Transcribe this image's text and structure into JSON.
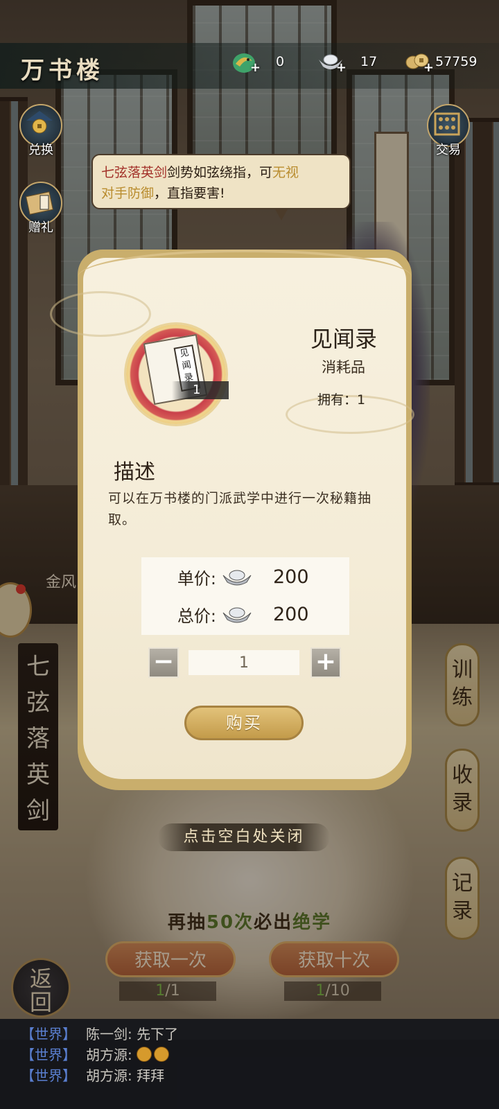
{
  "header": {
    "title": "万书楼",
    "currencies": [
      {
        "icon": "jade-dragon-icon",
        "value": "0"
      },
      {
        "icon": "silver-ingot-icon",
        "value": "17"
      },
      {
        "icon": "copper-coins-icon",
        "value": "57759"
      }
    ]
  },
  "side_buttons": {
    "exchange": "兑换",
    "gift": "赠礼",
    "trade": "交易"
  },
  "speech": {
    "part1": "七弦落英剑",
    "part2": "剑势如弦绕指，可",
    "part3": "无视",
    "part4": "对手防御",
    "part5": "，直指要害!"
  },
  "modal": {
    "item_name": "见闻录",
    "item_type": "消耗品",
    "owned_label": "拥有：1",
    "icon_quantity": "1",
    "book_text": "见闻录",
    "desc_title": "描述",
    "desc_text": "可以在万书楼的门派武学中进行一次秘籍抽取。",
    "unit_price_label": "单价:",
    "unit_price": "200",
    "total_price_label": "总价:",
    "total_price": "200",
    "quantity": "1",
    "minus": "−",
    "plus": "+",
    "buy_label": "购买"
  },
  "close_hint": "点击空白处关闭",
  "background": {
    "skill_name": "七弦落英剑",
    "right_tabs": [
      "训练",
      "收录",
      "记录"
    ],
    "jinfeng": "金风",
    "pull_hint_pre": "再抽",
    "pull_hint_num": "50次",
    "pull_hint_mid": "必出",
    "pull_hint_post": "绝学",
    "pull_once": "获取一次",
    "pull_ten": "获取十次",
    "ticket_once_have": "1",
    "ticket_once_need": "/1",
    "ticket_ten_have": "1",
    "ticket_ten_need": "/10",
    "back": "返回"
  },
  "chat": [
    {
      "channel": "【世界】",
      "name": "陈一剑:",
      "message": "先下了"
    },
    {
      "channel": "【世界】",
      "name": "胡方源:",
      "message": ""
    },
    {
      "channel": "【世界】",
      "name": "胡方源:",
      "message": "拜拜"
    }
  ]
}
